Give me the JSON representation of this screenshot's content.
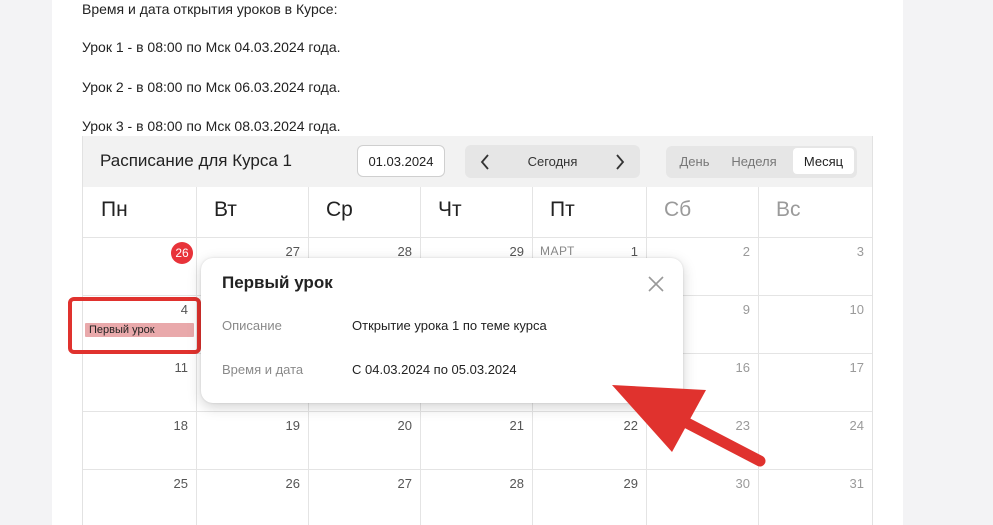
{
  "intro": {
    "heading": "Время и дата открытия уроков в Курсе:",
    "lessons": [
      "Урок 1 - в 08:00 по Мск 04.03.2024 года.",
      "Урок 2 - в 08:00 по Мск 06.03.2024 года.",
      "Урок 3 - в 08:00 по Мск 08.03.2024 года."
    ]
  },
  "calendar": {
    "title": "Расписание для Курса 1",
    "date_value": "01.03.2024",
    "nav": {
      "prev_icon": "chevron-left-icon",
      "today": "Сегодня",
      "next_icon": "chevron-right-icon"
    },
    "views": {
      "day": "День",
      "week": "Неделя",
      "month": "Месяц",
      "active": "month"
    },
    "weekdays": [
      "Пн",
      "Вт",
      "Ср",
      "Чт",
      "Пт",
      "Сб",
      "Вс"
    ],
    "month_label": "МАРТ",
    "weeks": [
      [
        "26",
        "27",
        "28",
        "29",
        "1",
        "2",
        "3"
      ],
      [
        "4",
        "",
        "",
        "",
        "",
        "9",
        "10"
      ],
      [
        "11",
        "",
        "",
        "",
        "",
        "16",
        "17"
      ],
      [
        "18",
        "19",
        "20",
        "21",
        "22",
        "23",
        "24"
      ],
      [
        "25",
        "26",
        "27",
        "28",
        "29",
        "30",
        "31"
      ]
    ],
    "today": "26",
    "event": {
      "label": "Первый урок",
      "color": "#e9a9ab"
    }
  },
  "popup": {
    "title": "Первый урок",
    "close_icon": "close-icon",
    "description_label": "Описание",
    "description_value": "Открытие урока 1 по теме курса",
    "datetime_label": "Время и дата",
    "datetime_value": "С 04.03.2024 по 05.03.2024"
  },
  "colors": {
    "annotation": "#e0322e",
    "today_badge": "#e8333a"
  }
}
